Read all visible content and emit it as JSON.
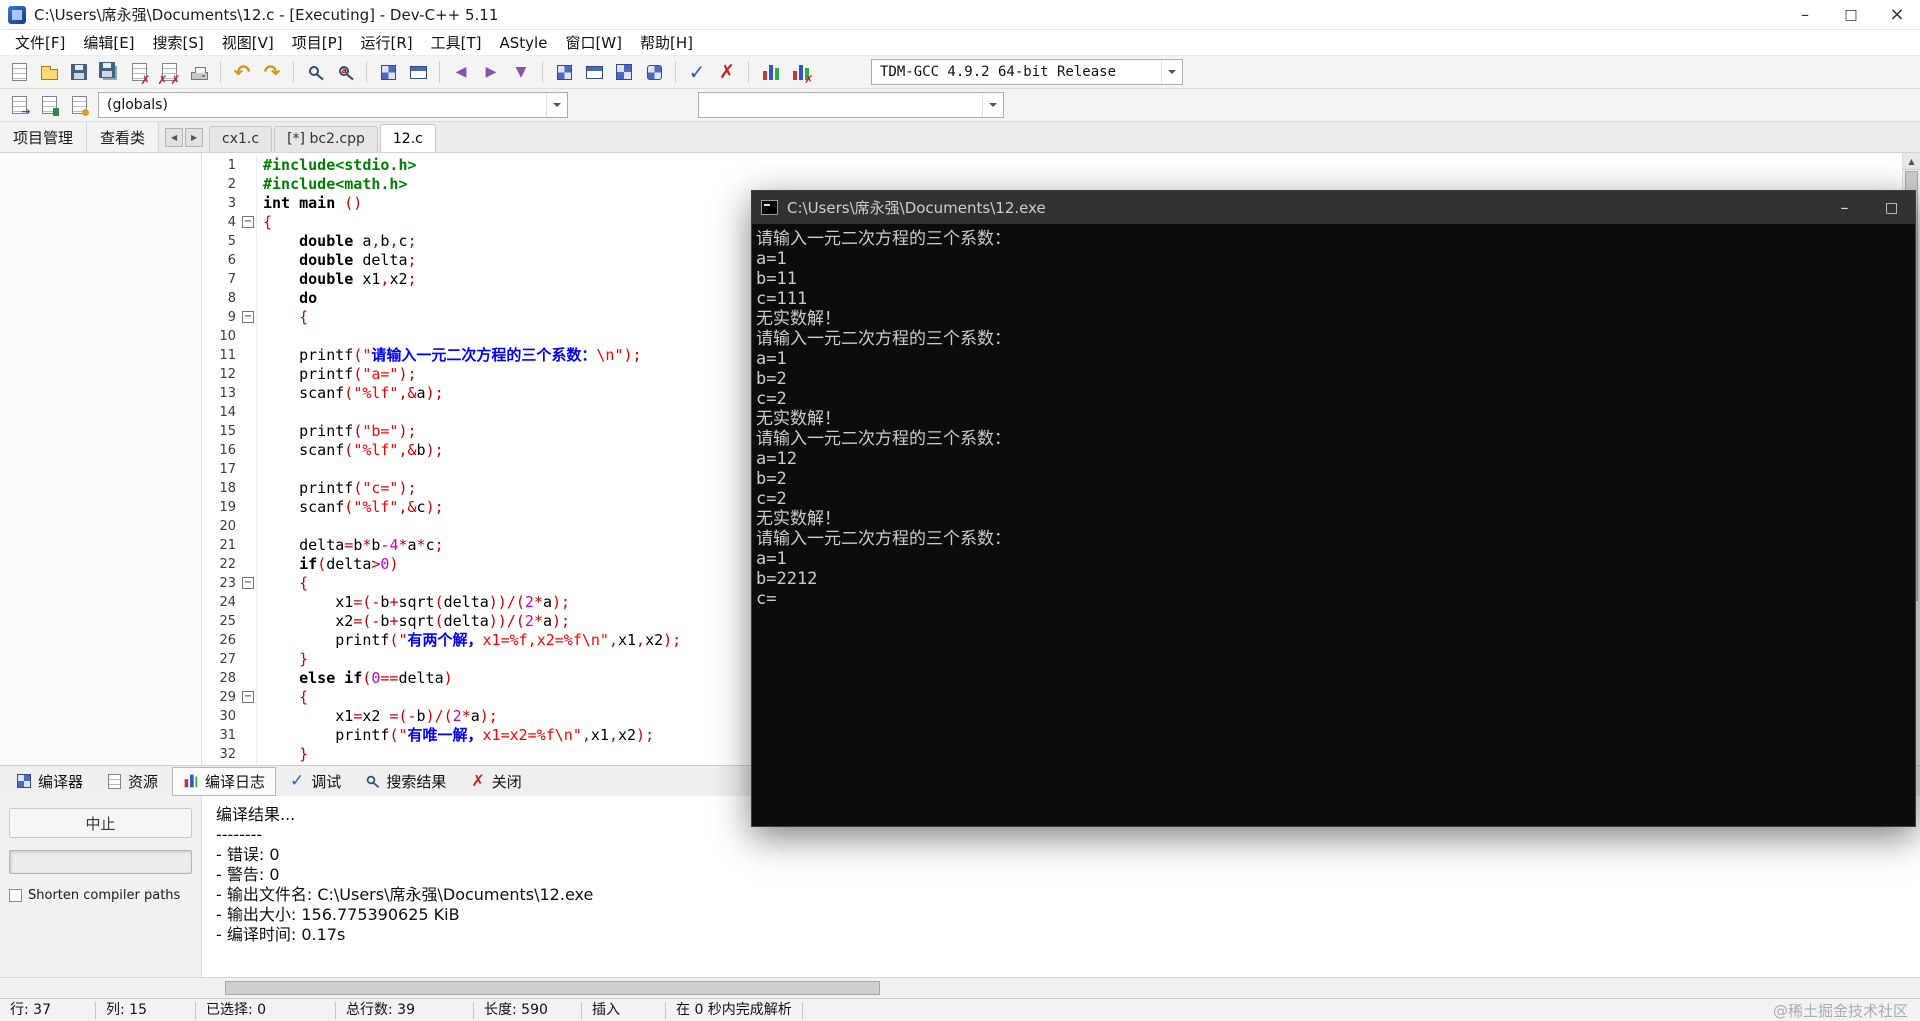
{
  "window": {
    "title": "C:\\Users\\席永强\\Documents\\12.c - [Executing] - Dev-C++ 5.11"
  },
  "menu": [
    "文件[F]",
    "编辑[E]",
    "搜索[S]",
    "视图[V]",
    "项目[P]",
    "运行[R]",
    "工具[T]",
    "AStyle",
    "窗口[W]",
    "帮助[H]"
  ],
  "toolbar1": [
    "new-file",
    "open-file",
    "save",
    "save-all",
    "close-file",
    "close-all",
    "print",
    "|",
    "undo",
    "redo",
    "|",
    "find",
    "replace",
    "|",
    "new-project",
    "open-project",
    "|",
    "nav-back",
    "nav-forward",
    "goto-line",
    "|",
    "compile",
    "run",
    "compile-run",
    "rebuild",
    "|",
    "debug-check",
    "abort-run",
    "|",
    "profile",
    "profile-delete"
  ],
  "toolbar2": [
    "swap-header-source",
    "bookmark",
    "goto-function"
  ],
  "toolbars": {
    "compiler": "TDM-GCC 4.9.2 64-bit Release",
    "globals": "(globals)",
    "members": ""
  },
  "panel_tabs": [
    "项目管理",
    "查看类"
  ],
  "editor_tabs": [
    {
      "label": "cx1.c",
      "active": false
    },
    {
      "label": "[*] bc2.cpp",
      "active": false
    },
    {
      "label": "12.c",
      "active": true
    }
  ],
  "code": {
    "lines": [
      {
        "n": 1,
        "fold": false,
        "seg": [
          [
            "g",
            "#include<stdio.h>"
          ]
        ]
      },
      {
        "n": 2,
        "fold": false,
        "seg": [
          [
            "g",
            "#include<math.h>"
          ]
        ]
      },
      {
        "n": 3,
        "fold": false,
        "seg": [
          [
            "k",
            "int"
          ],
          [
            "p",
            " "
          ],
          [
            "k",
            "main"
          ],
          [
            "p",
            " "
          ],
          [
            "s",
            "()"
          ]
        ]
      },
      {
        "n": 4,
        "fold": true,
        "seg": [
          [
            "s",
            "{"
          ]
        ]
      },
      {
        "n": 5,
        "fold": false,
        "seg": [
          [
            "p",
            "    "
          ],
          [
            "k",
            "double"
          ],
          [
            "p",
            " a"
          ],
          [
            "s",
            ","
          ],
          [
            "p",
            "b"
          ],
          [
            "s",
            ","
          ],
          [
            "p",
            "c"
          ],
          [
            "s",
            ";"
          ]
        ]
      },
      {
        "n": 6,
        "fold": false,
        "seg": [
          [
            "p",
            "    "
          ],
          [
            "k",
            "double"
          ],
          [
            "p",
            " delta"
          ],
          [
            "s",
            ";"
          ]
        ]
      },
      {
        "n": 7,
        "fold": false,
        "seg": [
          [
            "p",
            "    "
          ],
          [
            "k",
            "double"
          ],
          [
            "p",
            " x1"
          ],
          [
            "s",
            ","
          ],
          [
            "p",
            "x2"
          ],
          [
            "s",
            ";"
          ]
        ]
      },
      {
        "n": 8,
        "fold": false,
        "seg": [
          [
            "p",
            "    "
          ],
          [
            "k",
            "do"
          ]
        ]
      },
      {
        "n": 9,
        "fold": true,
        "seg": [
          [
            "p",
            "    "
          ],
          [
            "s",
            "{"
          ]
        ]
      },
      {
        "n": 10,
        "fold": false,
        "seg": []
      },
      {
        "n": 11,
        "fold": false,
        "seg": [
          [
            "p",
            "    "
          ],
          [
            "p",
            "printf"
          ],
          [
            "s",
            "("
          ],
          [
            "r",
            "\""
          ],
          [
            "z",
            "请输入一元二次方程的三个系数："
          ],
          [
            "r",
            "\\n\""
          ],
          [
            "s",
            ");"
          ]
        ]
      },
      {
        "n": 12,
        "fold": false,
        "seg": [
          [
            "p",
            "    "
          ],
          [
            "p",
            "printf"
          ],
          [
            "s",
            "("
          ],
          [
            "r",
            "\"a=\""
          ],
          [
            "s",
            ");"
          ]
        ]
      },
      {
        "n": 13,
        "fold": false,
        "seg": [
          [
            "p",
            "    "
          ],
          [
            "p",
            "scanf"
          ],
          [
            "s",
            "("
          ],
          [
            "r",
            "\"%lf\""
          ],
          [
            "s",
            ",&"
          ],
          [
            "p",
            "a"
          ],
          [
            "s",
            ");"
          ]
        ]
      },
      {
        "n": 14,
        "fold": false,
        "seg": []
      },
      {
        "n": 15,
        "fold": false,
        "seg": [
          [
            "p",
            "    "
          ],
          [
            "p",
            "printf"
          ],
          [
            "s",
            "("
          ],
          [
            "r",
            "\"b=\""
          ],
          [
            "s",
            ");"
          ]
        ]
      },
      {
        "n": 16,
        "fold": false,
        "seg": [
          [
            "p",
            "    "
          ],
          [
            "p",
            "scanf"
          ],
          [
            "s",
            "("
          ],
          [
            "r",
            "\"%lf\""
          ],
          [
            "s",
            ",&"
          ],
          [
            "p",
            "b"
          ],
          [
            "s",
            ");"
          ]
        ]
      },
      {
        "n": 17,
        "fold": false,
        "seg": []
      },
      {
        "n": 18,
        "fold": false,
        "seg": [
          [
            "p",
            "    "
          ],
          [
            "p",
            "printf"
          ],
          [
            "s",
            "("
          ],
          [
            "r",
            "\"c=\""
          ],
          [
            "s",
            ");"
          ]
        ]
      },
      {
        "n": 19,
        "fold": false,
        "seg": [
          [
            "p",
            "    "
          ],
          [
            "p",
            "scanf"
          ],
          [
            "s",
            "("
          ],
          [
            "r",
            "\"%lf\""
          ],
          [
            "s",
            ",&"
          ],
          [
            "p",
            "c"
          ],
          [
            "s",
            ");"
          ]
        ]
      },
      {
        "n": 20,
        "fold": false,
        "seg": []
      },
      {
        "n": 21,
        "fold": false,
        "seg": [
          [
            "p",
            "    "
          ],
          [
            "p",
            "delta"
          ],
          [
            "s",
            "="
          ],
          [
            "p",
            "b"
          ],
          [
            "s",
            "*"
          ],
          [
            "p",
            "b"
          ],
          [
            "s",
            "-"
          ],
          [
            "n",
            "4"
          ],
          [
            "s",
            "*"
          ],
          [
            "p",
            "a"
          ],
          [
            "s",
            "*"
          ],
          [
            "p",
            "c"
          ],
          [
            "s",
            ";"
          ]
        ]
      },
      {
        "n": 22,
        "fold": false,
        "seg": [
          [
            "p",
            "    "
          ],
          [
            "k",
            "if"
          ],
          [
            "s",
            "("
          ],
          [
            "p",
            "delta"
          ],
          [
            "s",
            ">"
          ],
          [
            "n",
            "0"
          ],
          [
            "s",
            ")"
          ]
        ]
      },
      {
        "n": 23,
        "fold": true,
        "seg": [
          [
            "p",
            "    "
          ],
          [
            "s",
            "{"
          ]
        ]
      },
      {
        "n": 24,
        "fold": false,
        "seg": [
          [
            "p",
            "        "
          ],
          [
            "p",
            "x1"
          ],
          [
            "s",
            "=(-"
          ],
          [
            "p",
            "b"
          ],
          [
            "s",
            "+"
          ],
          [
            "p",
            "sqrt"
          ],
          [
            "s",
            "("
          ],
          [
            "p",
            "delta"
          ],
          [
            "s",
            "))/("
          ],
          [
            "n",
            "2"
          ],
          [
            "s",
            "*"
          ],
          [
            "p",
            "a"
          ],
          [
            "s",
            ");"
          ]
        ]
      },
      {
        "n": 25,
        "fold": false,
        "seg": [
          [
            "p",
            "        "
          ],
          [
            "p",
            "x2"
          ],
          [
            "s",
            "=(-"
          ],
          [
            "p",
            "b"
          ],
          [
            "s",
            "+"
          ],
          [
            "p",
            "sqrt"
          ],
          [
            "s",
            "("
          ],
          [
            "p",
            "delta"
          ],
          [
            "s",
            "))/("
          ],
          [
            "n",
            "2"
          ],
          [
            "s",
            "*"
          ],
          [
            "p",
            "a"
          ],
          [
            "s",
            ");"
          ]
        ]
      },
      {
        "n": 26,
        "fold": false,
        "seg": [
          [
            "p",
            "        "
          ],
          [
            "p",
            "printf"
          ],
          [
            "s",
            "("
          ],
          [
            "r",
            "\""
          ],
          [
            "z",
            "有两个解，"
          ],
          [
            "r",
            "x1=%f,x2=%f\\n\""
          ],
          [
            "s",
            ","
          ],
          [
            "p",
            "x1"
          ],
          [
            "s",
            ","
          ],
          [
            "p",
            "x2"
          ],
          [
            "s",
            ");"
          ]
        ]
      },
      {
        "n": 27,
        "fold": false,
        "seg": [
          [
            "p",
            "    "
          ],
          [
            "s",
            "}"
          ]
        ]
      },
      {
        "n": 28,
        "fold": false,
        "seg": [
          [
            "p",
            "    "
          ],
          [
            "k",
            "else"
          ],
          [
            "p",
            " "
          ],
          [
            "k",
            "if"
          ],
          [
            "s",
            "("
          ],
          [
            "n",
            "0"
          ],
          [
            "s",
            "=="
          ],
          [
            "p",
            "delta"
          ],
          [
            "s",
            ")"
          ]
        ]
      },
      {
        "n": 29,
        "fold": true,
        "seg": [
          [
            "p",
            "    "
          ],
          [
            "s",
            "{"
          ]
        ]
      },
      {
        "n": 30,
        "fold": false,
        "seg": [
          [
            "p",
            "        "
          ],
          [
            "p",
            "x1"
          ],
          [
            "s",
            "="
          ],
          [
            "p",
            "x2"
          ],
          [
            "p",
            " "
          ],
          [
            "s",
            "=(-"
          ],
          [
            "p",
            "b"
          ],
          [
            "s",
            ")/("
          ],
          [
            "n",
            "2"
          ],
          [
            "s",
            "*"
          ],
          [
            "p",
            "a"
          ],
          [
            "s",
            ");"
          ]
        ]
      },
      {
        "n": 31,
        "fold": false,
        "seg": [
          [
            "p",
            "        "
          ],
          [
            "p",
            "printf"
          ],
          [
            "s",
            "("
          ],
          [
            "r",
            "\""
          ],
          [
            "z",
            "有唯一解，"
          ],
          [
            "r",
            "x1=x2=%f\\n\""
          ],
          [
            "s",
            ","
          ],
          [
            "p",
            "x1"
          ],
          [
            "s",
            ","
          ],
          [
            "p",
            "x2"
          ],
          [
            "s",
            ");"
          ]
        ]
      },
      {
        "n": 32,
        "fold": false,
        "seg": [
          [
            "p",
            "    "
          ],
          [
            "s",
            "}"
          ]
        ]
      }
    ]
  },
  "console": {
    "title": "C:\\Users\\席永强\\Documents\\12.exe",
    "lines": [
      "请输入一元二次方程的三个系数：",
      "a=1",
      "b=11",
      "c=111",
      "无实数解！",
      "请输入一元二次方程的三个系数：",
      "a=1",
      "b=2",
      "c=2",
      "无实数解！",
      "请输入一元二次方程的三个系数：",
      "a=12",
      "b=2",
      "c=2",
      "无实数解！",
      "请输入一元二次方程的三个系数：",
      "a=1",
      "b=2212",
      "c="
    ]
  },
  "bottom_tabs": [
    {
      "label": "编译器",
      "icon": "compiler",
      "active": false
    },
    {
      "label": "资源",
      "icon": "resource",
      "active": false
    },
    {
      "label": "编译日志",
      "icon": "log",
      "active": true
    },
    {
      "label": "调试",
      "icon": "debug",
      "active": false
    },
    {
      "label": "搜索结果",
      "icon": "search",
      "active": false
    },
    {
      "label": "关闭",
      "icon": "close",
      "active": false
    }
  ],
  "left_controls": {
    "abort": "中止",
    "checkbox_label": "Shorten compiler paths"
  },
  "log": {
    "lines": [
      "编译结果...",
      "--------",
      "- 错误: 0",
      "- 警告: 0",
      "- 输出文件名: C:\\Users\\席永强\\Documents\\12.exe",
      "- 输出大小: 156.775390625 KiB",
      "- 编译时间: 0.17s"
    ]
  },
  "status": [
    {
      "name": "status-cursor-line",
      "label": "行:  37"
    },
    {
      "name": "status-cursor-column",
      "label": "列:  15"
    },
    {
      "name": "status-selected",
      "label": "已选择:  0"
    },
    {
      "name": "status-total-lines",
      "label": "总行数:  39"
    },
    {
      "name": "status-length",
      "label": "长度:  590"
    },
    {
      "name": "status-insert-mode",
      "label": "插入"
    },
    {
      "name": "status-parse-info",
      "label": "在 0 秒内完成解析"
    }
  ],
  "watermark": "@稀土掘金技术社区",
  "colors": {
    "keyword": "#000000",
    "preprocessor": "#008000",
    "string": "#ff0000",
    "chinese_string": "#0000ff",
    "number": "#c800c8",
    "symbol": "#cc0000",
    "console_bg": "#0c0c0c",
    "console_text": "#cccccc"
  }
}
